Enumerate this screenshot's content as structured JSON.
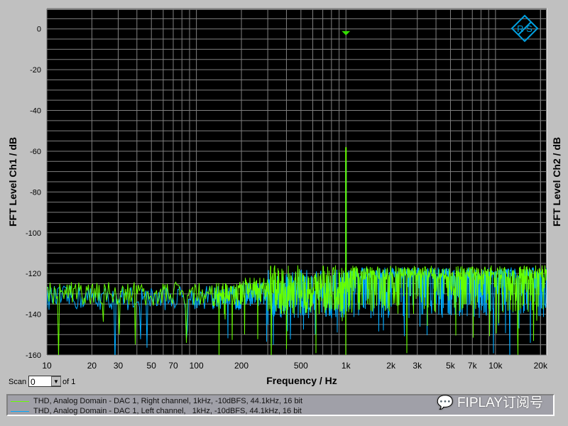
{
  "chart_data": {
    "type": "line",
    "title": "",
    "xlabel": "Frequency / Hz",
    "ylabel_left": "FFT Level Ch1 / dB",
    "ylabel_right": "FFT Level Ch2 / dB",
    "xscale": "log",
    "xlim": [
      10,
      22000
    ],
    "ylim": [
      -160,
      10
    ],
    "x_ticks": [
      10,
      20,
      30,
      50,
      70,
      100,
      200,
      500,
      1000,
      2000,
      3000,
      5000,
      7000,
      10000,
      20000
    ],
    "x_tick_labels": [
      "10",
      "20",
      "30",
      "50",
      "70",
      "100",
      "200",
      "500",
      "1k",
      "2k",
      "3k",
      "5k",
      "7k",
      "10k",
      "20k"
    ],
    "y_ticks": [
      0,
      -20,
      -40,
      -60,
      -80,
      -100,
      -120,
      -140,
      -160
    ],
    "y_tick_labels": [
      "0",
      "-20",
      "-40",
      "-60",
      "-80",
      "-100",
      "-120",
      "-140",
      "-160"
    ],
    "grid": true,
    "marker": {
      "x": 1000,
      "y": 0
    },
    "series": [
      {
        "name": "THD, Analog Domain - DAC 1, Right channel, 1kHz, -10dBFS, 44.1kHz, 16 bit",
        "color": "#66ff00",
        "peak": {
          "x": 1000,
          "y": -58
        },
        "noise_floor_db": -128
      },
      {
        "name": "THD, Analog Domain - DAC 1, Left channel,   1kHz, -10dBFS, 44.1kHz, 16 bit",
        "color": "#00aaff",
        "peak": {
          "x": 1000,
          "y": -65
        },
        "noise_floor_db": -130
      }
    ]
  },
  "scan": {
    "label": "Scan",
    "value": "0",
    "of": "of 1"
  },
  "watermark": "FIPLAY订阅号",
  "logo": "R&S"
}
